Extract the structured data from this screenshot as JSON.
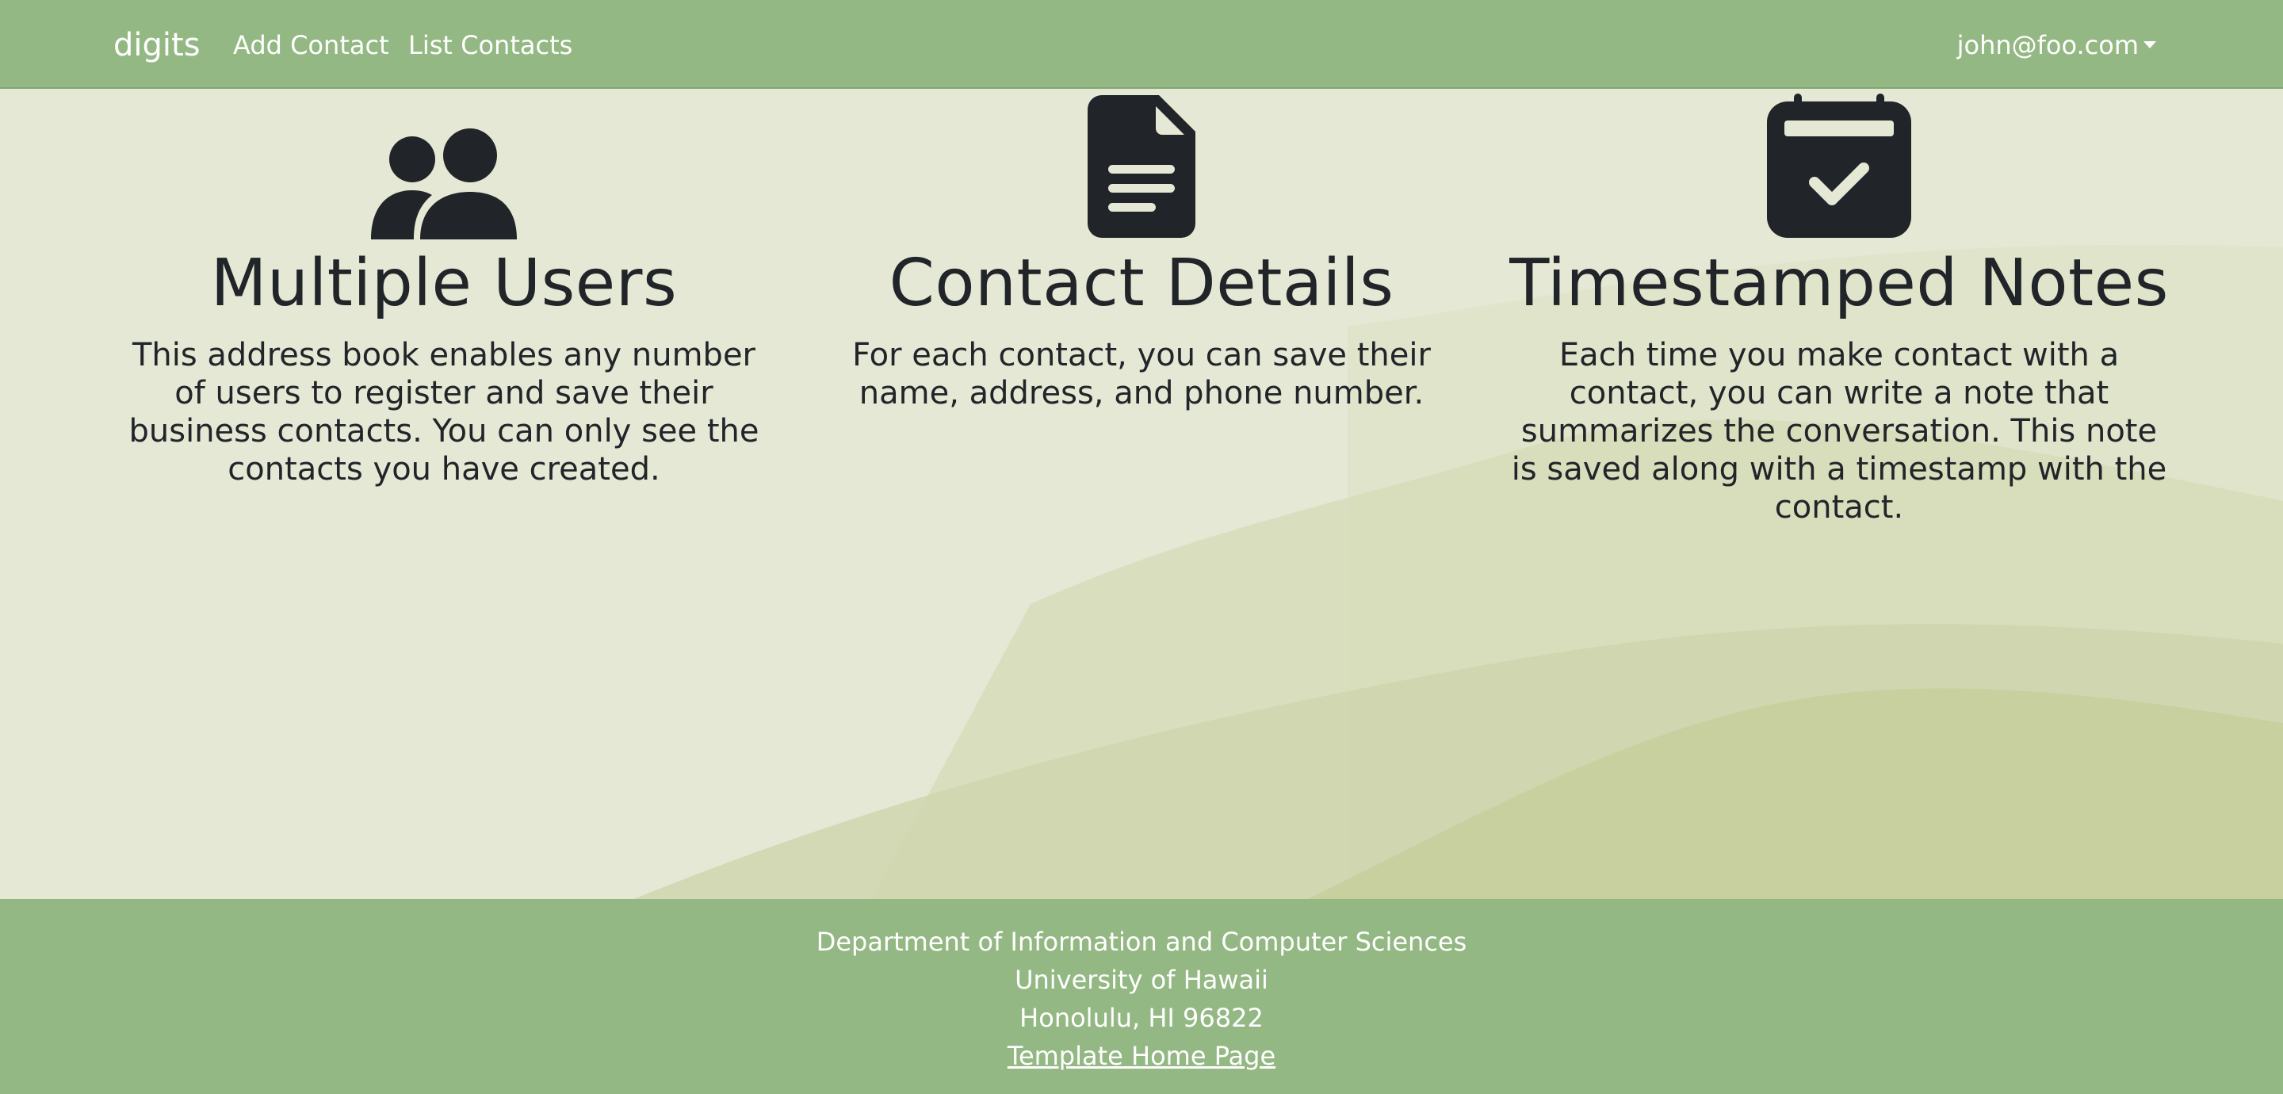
{
  "navbar": {
    "brand": "digits",
    "links": [
      {
        "label": "Add Contact"
      },
      {
        "label": "List Contacts"
      }
    ],
    "user_menu": "john@foo.com"
  },
  "features": [
    {
      "icon": "people-icon",
      "title": "Multiple Users",
      "description": "This address book enables any number of users to register and save their business contacts. You can only see the contacts you have created."
    },
    {
      "icon": "file-text-icon",
      "title": "Contact Details",
      "description": "For each contact, you can save their name, address, and phone number."
    },
    {
      "icon": "calendar-check-icon",
      "title": "Timestamped Notes",
      "description": "Each time you make contact with a contact, you can write a note that summarizes the conversation. This note is saved along with a timestamp with the contact."
    }
  ],
  "footer": {
    "line1": "Department of Information and Computer Sciences",
    "line2": "University of Hawaii",
    "line3": "Honolulu, HI 96822",
    "link": "Template Home Page"
  },
  "colors": {
    "navbar_bg": "#94b883",
    "text_dark": "#212529",
    "page_bg": "#e4e8d4"
  }
}
